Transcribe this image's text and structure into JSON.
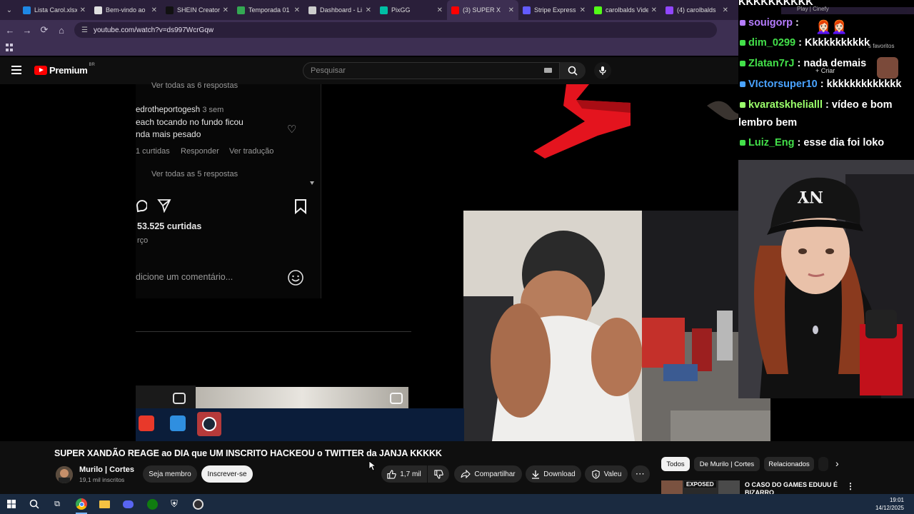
{
  "browser": {
    "tabs": [
      {
        "title": "Lista Carol.xlsx",
        "color": "#1e88e5",
        "active": false
      },
      {
        "title": "Bem-vindo ao",
        "color": "#e0e0e0",
        "active": false
      },
      {
        "title": "SHEIN Creator",
        "color": "#111111",
        "active": false
      },
      {
        "title": "Temporada 01",
        "color": "#34a853",
        "active": false
      },
      {
        "title": "Dashboard - Li",
        "color": "#cccccc",
        "active": false
      },
      {
        "title": "PixGG",
        "color": "#00bfa5",
        "active": false
      },
      {
        "title": "(3) SUPER X",
        "color": "#ff0000",
        "active": true
      },
      {
        "title": "Stripe Express",
        "color": "#635bff",
        "active": false
      },
      {
        "title": "carolbalds Vide",
        "color": "#53fc18",
        "active": false
      },
      {
        "title": "(4) carolbalds",
        "color": "#9146ff",
        "active": false
      }
    ],
    "url": "youtube.com/watch?v=ds997WcrGqw",
    "partial_tab": "Play | Cinefy",
    "favorites_label": "s favoritos"
  },
  "youtube": {
    "logo_text": "Premium",
    "logo_region": "BR",
    "search_placeholder": "Pesquisar",
    "create_label": "Criar"
  },
  "instagram_overlay": {
    "view_replies_6": "Ver todas as 6 respostas",
    "comment_user": "edrotheportogesh",
    "comment_time": "3 sem",
    "comment_line1": "each tocando no fundo ficou",
    "comment_line2": "nda mais pesado",
    "comment_likes": "1 curtidas",
    "reply_label": "Responder",
    "translate_label": "Ver tradução",
    "view_replies_5": "Ver todas as 5 respostas",
    "total_likes": "53.525 curtidas",
    "date_fragment": "rço",
    "add_comment": "dicione um comentário..."
  },
  "chat": {
    "top_line": "KKKKKKKKKK",
    "messages": [
      {
        "user": "souigorp",
        "text": " :",
        "color": "#b67cff"
      },
      {
        "user": "dim_0299",
        "text": " : Kkkkkkkkkkk",
        "color": "#43e04a"
      },
      {
        "user": "Zlatan7rJ",
        "text": " : nada demais",
        "color": "#43e04a"
      },
      {
        "user": "VIctorsuper10",
        "text": " : kkkkkkkkkkkkk",
        "color": "#4aa3ff"
      },
      {
        "user": "kvaratskhelialll",
        "text": " : vídeo e bom",
        "color": "#9bff6b",
        "text2": "lembro bem"
      },
      {
        "user": "Luiz_Eng",
        "text": " : esse dia foi loko",
        "color": "#43e04a"
      }
    ]
  },
  "video": {
    "title": "SUPER XANDÃO REAGE ao DIA que UM INSCRITO HACKEOU o TWITTER da JANJA KKKKK",
    "channel_name": "Murilo | Cortes",
    "channel_subs": "19,1 mil inscritos",
    "join_label": "Seja membro",
    "subscribe_label": "Inscrever-se",
    "like_count": "1,7 mil",
    "share_label": "Compartilhar",
    "download_label": "Download",
    "thanks_label": "Valeu"
  },
  "sidebar_recs": {
    "chips": [
      "Todos",
      "De Murilo | Cortes",
      "Relacionados"
    ],
    "rec_title_line1": "O CASO DO GAMES EDUUU É",
    "rec_title_line2": "BIZARRO",
    "rec_thumb_label": "EXPOSED"
  },
  "system": {
    "time": "19:01",
    "date": "14/12/2025"
  }
}
